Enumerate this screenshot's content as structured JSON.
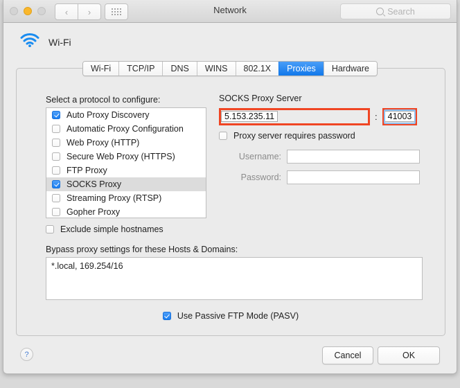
{
  "window": {
    "title": "Network",
    "traffic_lights": [
      "close",
      "minimize",
      "zoom"
    ],
    "search_placeholder": "Search",
    "nav_back": "‹",
    "nav_forward": "›"
  },
  "service": {
    "name": "Wi-Fi",
    "icon": "wifi-icon"
  },
  "tabs": [
    {
      "label": "Wi-Fi",
      "active": false
    },
    {
      "label": "TCP/IP",
      "active": false
    },
    {
      "label": "DNS",
      "active": false
    },
    {
      "label": "WINS",
      "active": false
    },
    {
      "label": "802.1X",
      "active": false
    },
    {
      "label": "Proxies",
      "active": true
    },
    {
      "label": "Hardware",
      "active": false
    }
  ],
  "protocols": {
    "label": "Select a protocol to configure:",
    "items": [
      {
        "label": "Auto Proxy Discovery",
        "checked": true,
        "selected": false
      },
      {
        "label": "Automatic Proxy Configuration",
        "checked": false,
        "selected": false
      },
      {
        "label": "Web Proxy (HTTP)",
        "checked": false,
        "selected": false
      },
      {
        "label": "Secure Web Proxy (HTTPS)",
        "checked": false,
        "selected": false
      },
      {
        "label": "FTP Proxy",
        "checked": false,
        "selected": false
      },
      {
        "label": "SOCKS Proxy",
        "checked": true,
        "selected": true
      },
      {
        "label": "Streaming Proxy (RTSP)",
        "checked": false,
        "selected": false
      },
      {
        "label": "Gopher Proxy",
        "checked": false,
        "selected": false
      }
    ]
  },
  "exclude_simple_hostnames": {
    "label": "Exclude simple hostnames",
    "checked": false
  },
  "bypass": {
    "label": "Bypass proxy settings for these Hosts & Domains:",
    "value": "*.local, 169.254/16"
  },
  "passive_ftp": {
    "label": "Use Passive FTP Mode (PASV)",
    "checked": true
  },
  "proxy_server": {
    "title": "SOCKS Proxy Server",
    "host": "5.153.235.11",
    "separator": ":",
    "port": "41003",
    "requires_password_label": "Proxy server requires password",
    "requires_password_checked": false,
    "username_label": "Username:",
    "username_value": "",
    "password_label": "Password:",
    "password_value": ""
  },
  "footer": {
    "help_label": "?",
    "cancel_label": "Cancel",
    "ok_label": "OK"
  },
  "colors": {
    "accent_blue": "#1178ea",
    "annotation_red": "#f04523",
    "focus_ring": "#8ec2f2",
    "window_bg": "#ececec",
    "panel_bg": "#ebebeb"
  }
}
